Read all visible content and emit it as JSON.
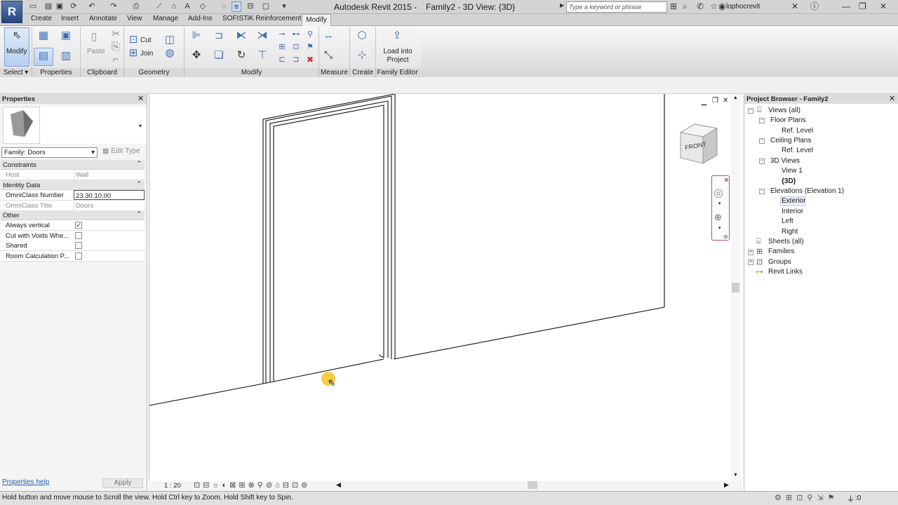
{
  "titlebar": {
    "app_title": "Autodesk Revit 2015 -",
    "view_title": "Family2 - 3D View: {3D}",
    "search_placeholder": "Type a keyword or phrase",
    "username": "lophocrevit",
    "app_button": "R"
  },
  "tabs": [
    "Create",
    "Insert",
    "Annotate",
    "View",
    "Manage",
    "Add-Ins",
    "SOFISTiK Reinforcement",
    "Modify"
  ],
  "active_tab": "Modify",
  "ribbon": {
    "panels": [
      "Select",
      "Properties",
      "Clipboard",
      "Geometry",
      "Modify",
      "Measure",
      "Create",
      "Family Editor"
    ],
    "modify_label": "Modify",
    "paste_label": "Paste",
    "cut_label": "Cut",
    "join_label": "Join",
    "load_into_project": "Load into Project"
  },
  "properties": {
    "title": "Properties",
    "family_select": "Family: Doors",
    "edit_type": "Edit Type",
    "groups": [
      {
        "name": "Constraints",
        "rows": [
          {
            "key": "Host",
            "value": "Wall",
            "readonly": true
          }
        ]
      },
      {
        "name": "Identity Data",
        "rows": [
          {
            "key": "OmniClass Number",
            "value": "23.30.10.00",
            "readonly": false
          },
          {
            "key": "OmniClass Title",
            "value": "Doors",
            "readonly": true
          }
        ]
      },
      {
        "name": "Other",
        "rows": [
          {
            "key": "Always vertical",
            "checked": true
          },
          {
            "key": "Cut with Voids Whe...",
            "checked": false
          },
          {
            "key": "Shared",
            "checked": false
          },
          {
            "key": "Room Calculation P...",
            "checked": false
          }
        ]
      }
    ],
    "help_link": "Properties help",
    "apply": "Apply"
  },
  "viewport": {
    "scale": "1 : 20",
    "viewcube_face": "FRONT"
  },
  "browser": {
    "title": "Project Browser - Family2",
    "tree": [
      {
        "label": "Views (all)",
        "depth": 0,
        "expanded": true
      },
      {
        "label": "Floor Plans",
        "depth": 1,
        "expanded": true
      },
      {
        "label": "Ref. Level",
        "depth": 2
      },
      {
        "label": "Ceiling Plans",
        "depth": 1,
        "expanded": true
      },
      {
        "label": "Ref. Level",
        "depth": 2
      },
      {
        "label": "3D Views",
        "depth": 1,
        "expanded": true
      },
      {
        "label": "View 1",
        "depth": 2
      },
      {
        "label": "{3D}",
        "depth": 2,
        "bold": true
      },
      {
        "label": "Elevations (Elevation 1)",
        "depth": 1,
        "expanded": true
      },
      {
        "label": "Exterior",
        "depth": 2,
        "selected": true
      },
      {
        "label": "Interior",
        "depth": 2
      },
      {
        "label": "Left",
        "depth": 2
      },
      {
        "label": "Right",
        "depth": 2
      },
      {
        "label": "Sheets (all)",
        "depth": 0
      },
      {
        "label": "Families",
        "depth": 0,
        "expanded": false
      },
      {
        "label": "Groups",
        "depth": 0,
        "expanded": false
      },
      {
        "label": "Revit Links",
        "depth": 0
      }
    ]
  },
  "status": {
    "text": "Hold button and move mouse to Scroll the view. Hold Ctrl key to Zoom. Hold Shift key to Spin.",
    "count": ":0"
  }
}
